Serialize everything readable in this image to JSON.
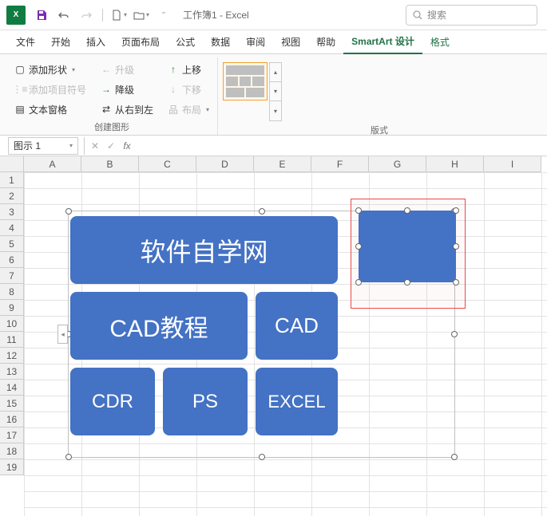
{
  "app": {
    "icon_text": "X",
    "title": "工作簿1 - Excel"
  },
  "search": {
    "placeholder": "搜索"
  },
  "tabs": {
    "file": "文件",
    "home": "开始",
    "insert": "插入",
    "layout": "页面布局",
    "formula": "公式",
    "data": "数据",
    "review": "审阅",
    "view": "视图",
    "help": "帮助",
    "smartart_design": "SmartArt 设计",
    "format": "格式"
  },
  "ribbon": {
    "add_shape": "添加形状",
    "add_bullet": "添加项目符号",
    "text_pane": "文本窗格",
    "promote": "升级",
    "demote": "降级",
    "rtl": "从右到左",
    "move_up": "上移",
    "move_down": "下移",
    "layout": "布局",
    "group_create": "创建图形",
    "group_layouts": "版式"
  },
  "namebox": {
    "value": "图示 1"
  },
  "columns": [
    "A",
    "B",
    "C",
    "D",
    "E",
    "F",
    "G",
    "H",
    "I"
  ],
  "rows": [
    "1",
    "2",
    "3",
    "4",
    "5",
    "6",
    "7",
    "8",
    "9",
    "10",
    "11",
    "12",
    "13",
    "14",
    "15",
    "16",
    "17",
    "18",
    "19"
  ],
  "smartart": {
    "big": "软件自学网",
    "mid1": "CAD教程",
    "mid2": "CAD",
    "s1": "CDR",
    "s2": "PS",
    "s3": "EXCEL"
  }
}
